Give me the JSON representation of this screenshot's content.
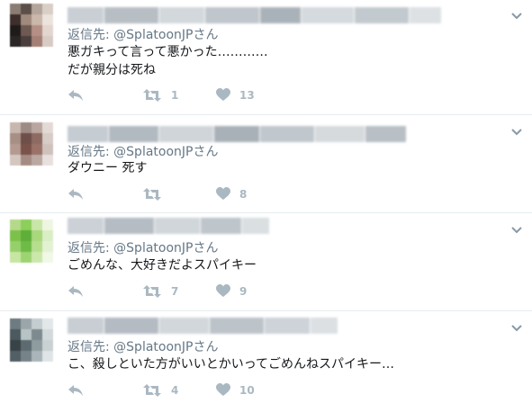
{
  "tweets": [
    {
      "reply_label": "返信先:",
      "reply_handle": "@SplatoonJPさん",
      "lines": [
        "悪ガキって言って悪かった…………",
        "だが親分は死ね"
      ],
      "replies": "",
      "retweets": "1",
      "likes": "13"
    },
    {
      "reply_label": "返信先:",
      "reply_handle": "@SplatoonJPさん",
      "lines": [
        "ダウニー 死す"
      ],
      "replies": "",
      "retweets": "",
      "likes": "8"
    },
    {
      "reply_label": "返信先:",
      "reply_handle": "@SplatoonJPさん",
      "lines": [
        "ごめんな、大好きだよスパイキー"
      ],
      "replies": "",
      "retweets": "7",
      "likes": "9"
    },
    {
      "reply_label": "返信先:",
      "reply_handle": "@SplatoonJPさん",
      "lines": [
        "こ、殺しといた方がいいとかいってごめんねスパイキー…"
      ],
      "replies": "",
      "retweets": "4",
      "likes": "10"
    }
  ],
  "colors": {
    "icon_gray": "#aab8c2",
    "meta_gray": "#657786",
    "text": "#14171a",
    "divider": "#e6ecf0"
  },
  "icons": [
    "reply-icon",
    "retweet-icon",
    "heart-icon",
    "chevron-down-icon"
  ]
}
